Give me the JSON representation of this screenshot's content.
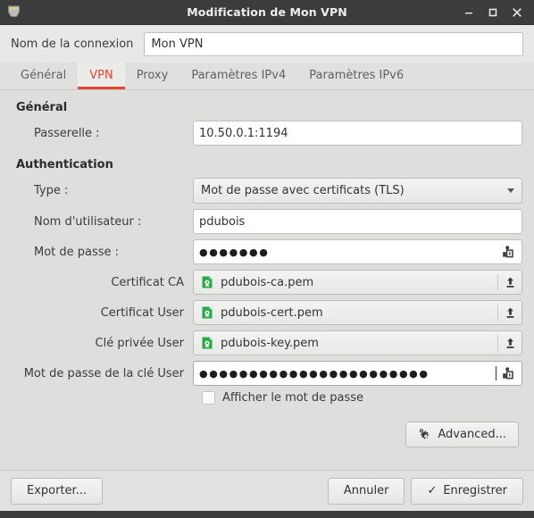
{
  "window": {
    "title": "Modification de Mon VPN",
    "icon": "ethernet-port-icon",
    "controls": {
      "minimize": "–",
      "maximize": "□",
      "close": "✕"
    }
  },
  "connection_name": {
    "label": "Nom de la connexion",
    "value": "Mon VPN",
    "placeholder": ""
  },
  "tabs": [
    {
      "label": "Général",
      "active": false
    },
    {
      "label": "VPN",
      "active": true
    },
    {
      "label": "Proxy",
      "active": false
    },
    {
      "label": "Paramètres IPv4",
      "active": false
    },
    {
      "label": "Paramètres IPv6",
      "active": false
    }
  ],
  "sections": {
    "general": {
      "title": "Général",
      "gateway": {
        "label": "Passerelle :",
        "value": "10.50.0.1:1194"
      }
    },
    "authentication": {
      "title": "Authentication",
      "type": {
        "label": "Type :",
        "value": "Mot de passe avec certificats (TLS)"
      },
      "username": {
        "label": "Nom d'utilisateur :",
        "value": "pdubois"
      },
      "password": {
        "label": "Mot de passe :",
        "value": "●●●●●●●",
        "storage_icon": "password-storage-icon"
      },
      "ca_cert": {
        "label": "Certificat CA",
        "value": "pdubois-ca.pem",
        "file_icon": "certificate-file-icon",
        "upload_icon": "upload-icon"
      },
      "user_cert": {
        "label": "Certificat User",
        "value": "pdubois-cert.pem",
        "file_icon": "certificate-file-icon",
        "upload_icon": "upload-icon"
      },
      "private_key": {
        "label": "Clé privée User",
        "value": "pdubois-key.pem",
        "file_icon": "certificate-file-icon",
        "upload_icon": "upload-icon"
      },
      "key_password": {
        "label": "Mot de passe de la clé User",
        "value": "●●●●●●●●●●●●●●●●●●●●●●●",
        "storage_icon": "password-storage-icon"
      },
      "show_password": {
        "label": "Afficher le mot de passe",
        "checked": false
      }
    }
  },
  "advanced_button": {
    "label": "Advanced...",
    "icon": "gear-icon"
  },
  "action_bar": {
    "export_label": "Exporter...",
    "cancel_label": "Annuler",
    "save_label": "Enregistrer",
    "save_icon": "✓"
  },
  "colors": {
    "accent": "#e4452c",
    "titlebar": "#3c3c3c",
    "window_bg": "#e8e8e7",
    "content_bg": "#dededc",
    "cert_green": "#2aa84a"
  }
}
